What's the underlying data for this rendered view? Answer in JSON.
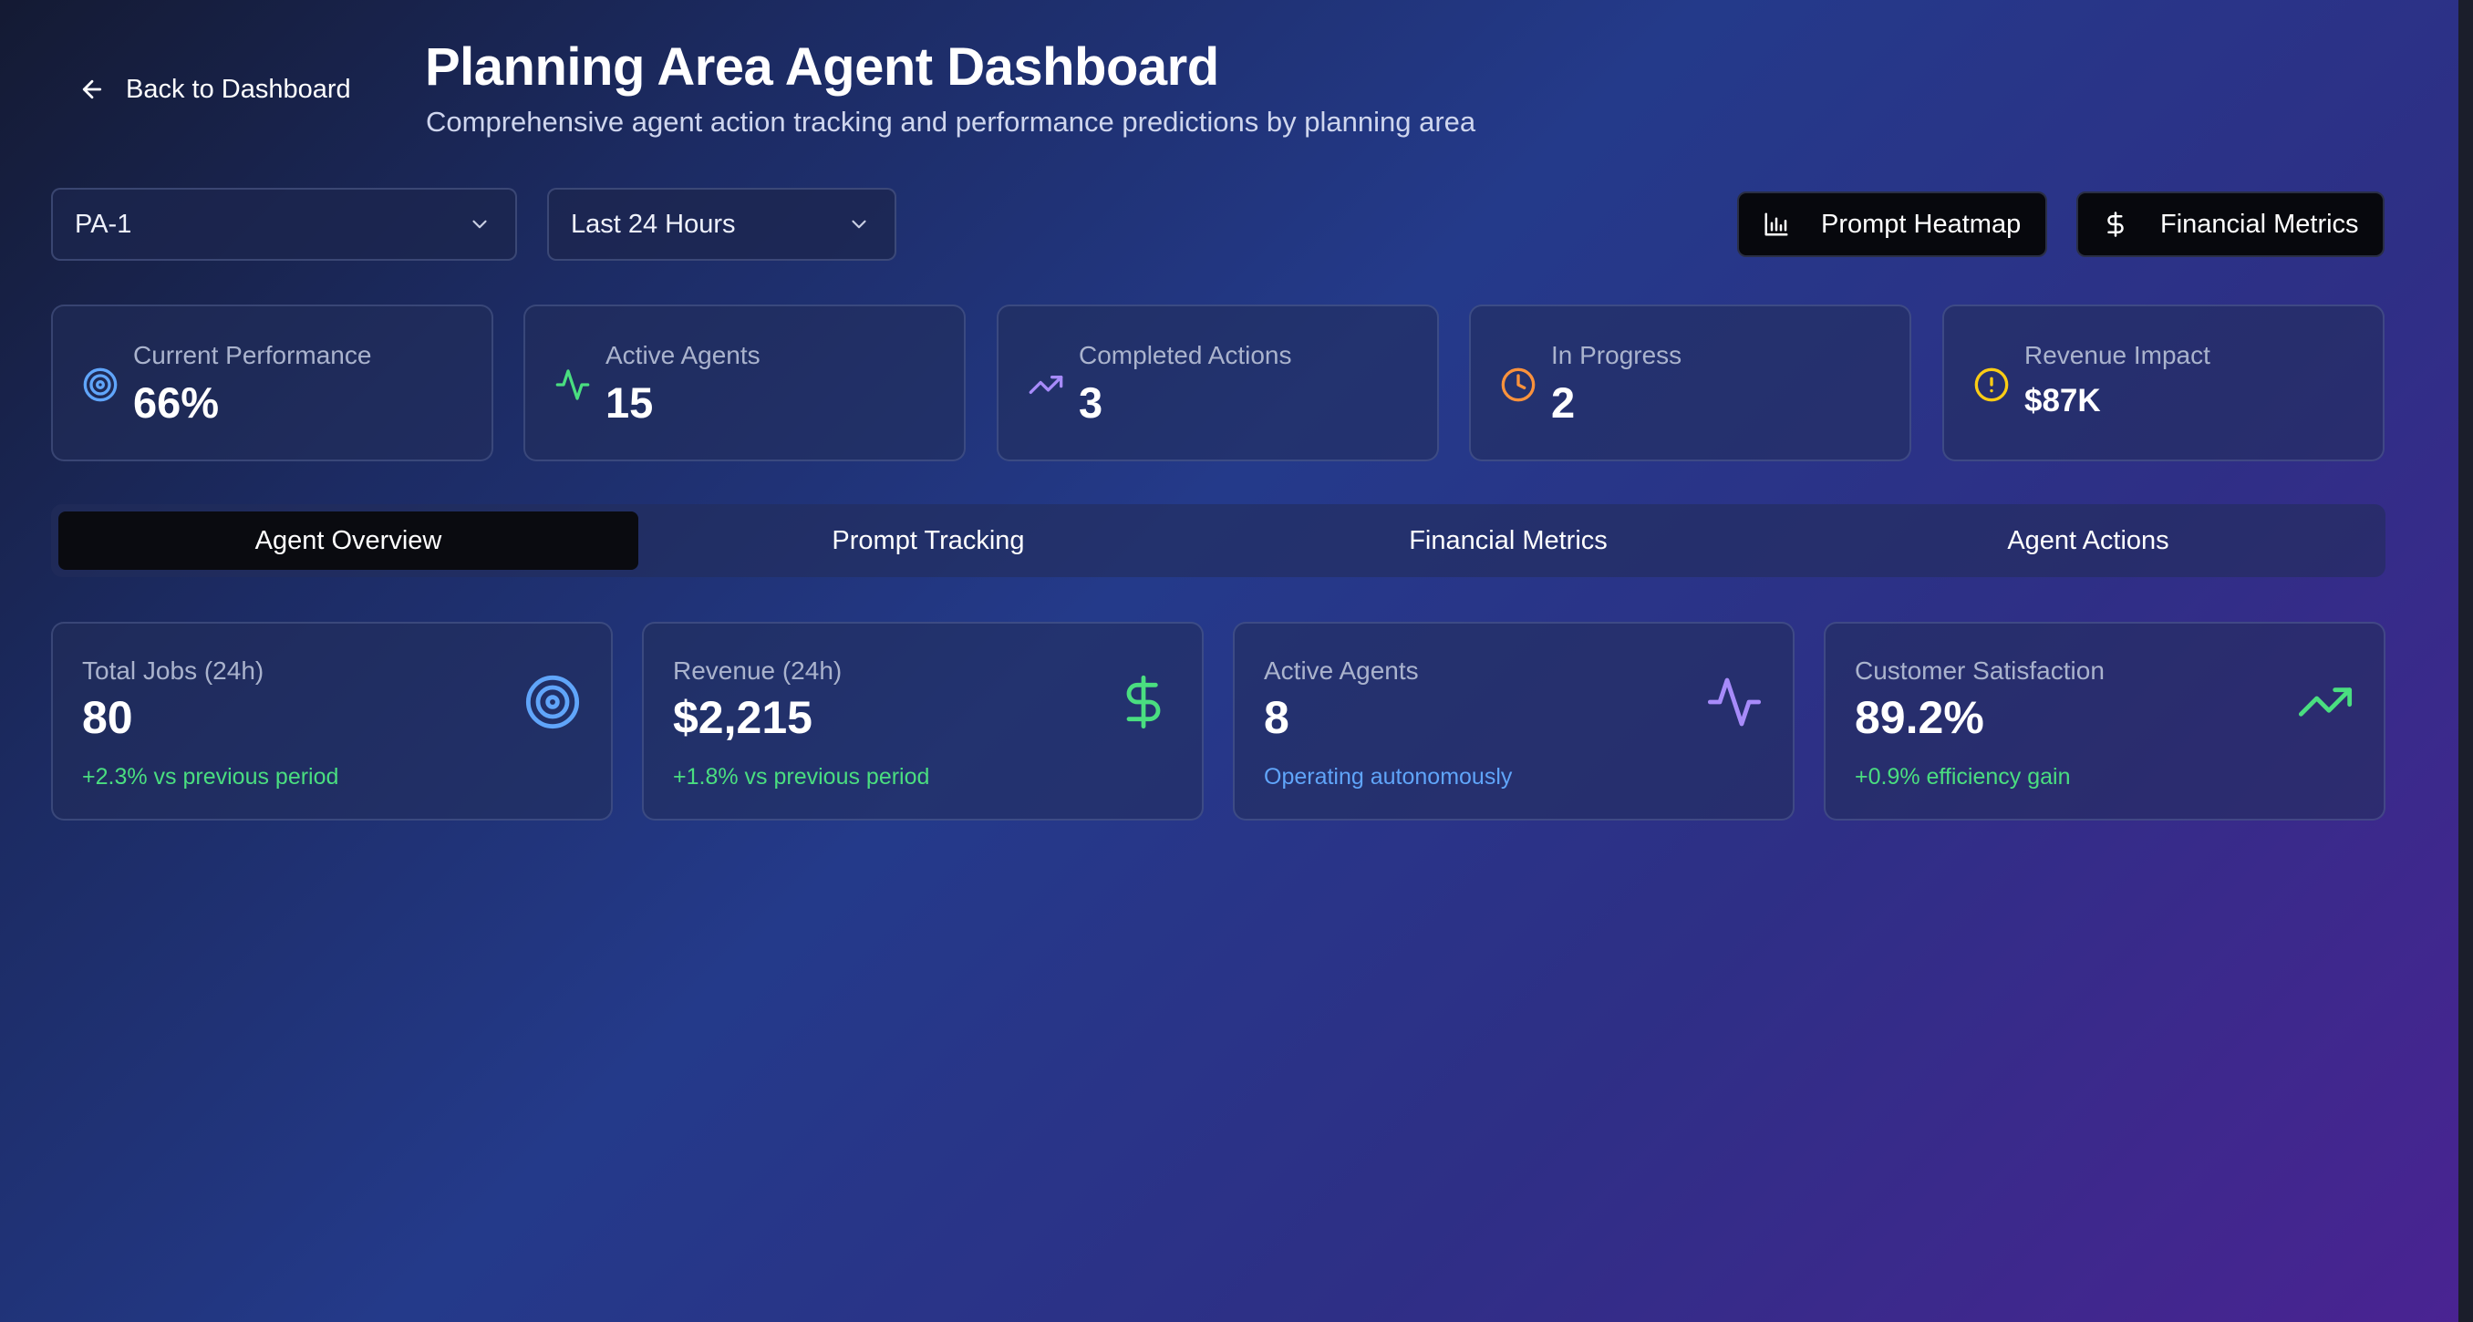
{
  "header": {
    "back_label": "Back to Dashboard",
    "title": "Planning Area Agent Dashboard",
    "subtitle": "Comprehensive agent action tracking and performance predictions by planning area"
  },
  "filters": {
    "planning_area": "PA-1",
    "time_range": "Last 24 Hours"
  },
  "actions": {
    "heatmap_label": "Prompt Heatmap",
    "financial_label": "Financial Metrics"
  },
  "stats": [
    {
      "label": "Current Performance",
      "value": "66%",
      "icon": "target-icon",
      "color": "#60a5fa"
    },
    {
      "label": "Active Agents",
      "value": "15",
      "icon": "activity-icon",
      "color": "#4ade80"
    },
    {
      "label": "Completed Actions",
      "value": "3",
      "icon": "trending-up-icon",
      "color": "#a78bfa"
    },
    {
      "label": "In Progress",
      "value": "2",
      "icon": "clock-icon",
      "color": "#fb923c"
    },
    {
      "label": "Revenue Impact",
      "value": "$87K",
      "icon": "alert-circle-icon",
      "color": "#facc15"
    }
  ],
  "tabs": [
    {
      "label": "Agent Overview",
      "active": true
    },
    {
      "label": "Prompt Tracking",
      "active": false
    },
    {
      "label": "Financial Metrics",
      "active": false
    },
    {
      "label": "Agent Actions",
      "active": false
    }
  ],
  "metrics": [
    {
      "label": "Total Jobs (24h)",
      "value": "80",
      "note": "+2.3% vs previous period",
      "icon": "target-icon",
      "color": "#60a5fa"
    },
    {
      "label": "Revenue (24h)",
      "value": "$2,215",
      "note": "+1.8% vs previous period",
      "icon": "dollar-icon",
      "color": "#4ade80"
    },
    {
      "label": "Active Agents",
      "value": "8",
      "note": "Operating autonomously",
      "icon": "activity-icon",
      "color": "#a78bfa"
    },
    {
      "label": "Customer Satisfaction",
      "value": "89.2%",
      "note": "+0.9% efficiency gain",
      "icon": "trending-up-icon",
      "color": "#4ade80"
    }
  ]
}
